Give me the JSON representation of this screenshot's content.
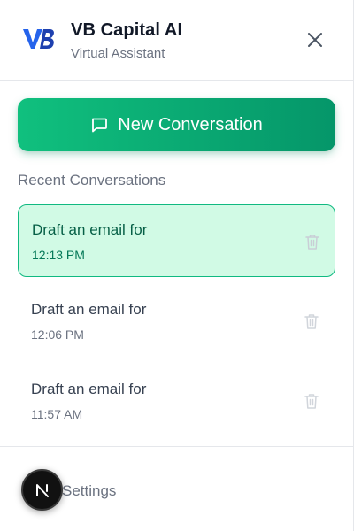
{
  "header": {
    "logo_text": "VB",
    "title": "VB Capital AI",
    "subtitle": "Virtual Assistant",
    "close_icon": "close-icon"
  },
  "actions": {
    "new_conversation_label": "New Conversation",
    "new_conversation_icon": "message-square-icon"
  },
  "conversations": {
    "section_title": "Recent Conversations",
    "items": [
      {
        "title": "Draft an email for",
        "time": "12:13 PM",
        "active": true
      },
      {
        "title": "Draft an email for",
        "time": "12:06 PM",
        "active": false
      },
      {
        "title": "Draft an email for",
        "time": "11:57 AM",
        "active": false
      }
    ],
    "delete_icon": "trash-icon"
  },
  "footer": {
    "settings_label": "Settings",
    "badge_letter": "N"
  },
  "colors": {
    "accent_green": "#10b981",
    "accent_green_dark": "#059669",
    "active_bg": "#d1fae5",
    "logo_blue": "#1d4ed8"
  }
}
